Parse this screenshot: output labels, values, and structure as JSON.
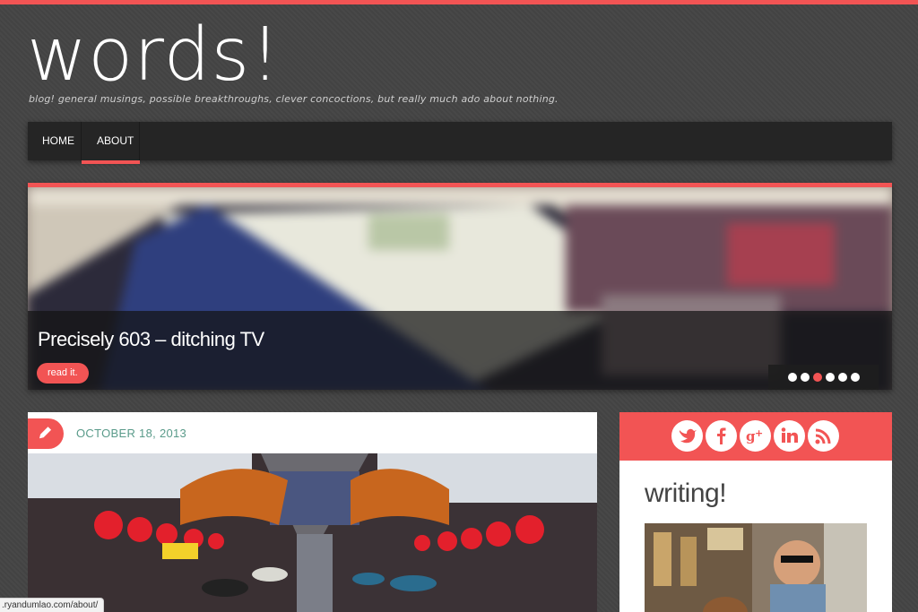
{
  "site": {
    "title": "words!",
    "tagline": "blog! general musings, possible breakthroughs, clever concoctions, but really much ado about nothing."
  },
  "nav": {
    "items": [
      {
        "label": "Home",
        "active": false
      },
      {
        "label": "About",
        "active": true
      }
    ]
  },
  "slider": {
    "title": "Precisely 603 – ditching TV",
    "button_label": "read it.",
    "slide_count": 6,
    "active_index": 2
  },
  "post": {
    "date": "OCTOBER 18, 2013"
  },
  "sidebar": {
    "social_icons": [
      "twitter-icon",
      "facebook-icon",
      "google-plus-icon",
      "linkedin-icon",
      "rss-icon"
    ],
    "widget_title": "writing!"
  },
  "status_bar": {
    "url": ".ryandumlao.com/about/"
  },
  "colors": {
    "accent": "#f25454",
    "background": "#444444",
    "nav": "#252525",
    "date": "#5a9b8a"
  }
}
